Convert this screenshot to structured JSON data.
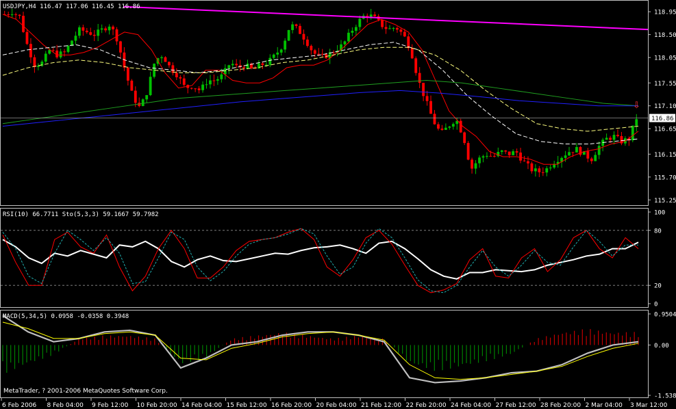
{
  "window": {
    "symbol_header": "USDJPY,H4  116.47 117.06 116.45 116.86",
    "copyright": "MetaTrader, ? 2001-2006 MetaQuotes Software Corp."
  },
  "colors": {
    "background": "#000000",
    "border": "#c0c0c0",
    "bull_candle": "#00c000",
    "bear_candle": "#ff0000",
    "trendline": "#ff00ff",
    "ma_fast": "#ff0000",
    "ma_mid": "#ffffff",
    "ma_slow": "#ffff80",
    "ma_green": "#20a020",
    "ma_blue": "#2020ff",
    "rsi": "#ffffff",
    "stoch_main": "#ff0000",
    "stoch_signal": "#20b0b0",
    "macd_main": "#c0c0c0",
    "macd_signal": "#ffff00",
    "macd_hist_up": "#c00000",
    "macd_hist_down": "#008000"
  },
  "chart_data": [
    {
      "type": "candlestick",
      "title": "USDJPY,H4  116.47 117.06 116.45 116.86",
      "ylim": [
        115.2,
        119.1
      ],
      "y_ticks": [
        "118.95",
        "118.50",
        "118.05",
        "117.55",
        "117.10",
        "116.86",
        "116.65",
        "116.15",
        "115.70",
        "115.25"
      ],
      "current_price": 116.86,
      "current_price_label": "116.86",
      "x_tick_labels": [
        "6 Feb 2006",
        "8 Feb 04:00",
        "9 Feb 12:00",
        "10 Feb 20:00",
        "14 Feb 04:00",
        "15 Feb 12:00",
        "16 Feb 20:00",
        "20 Feb 04:00",
        "21 Feb 12:00",
        "22 Feb 20:00",
        "24 Feb 04:00",
        "27 Feb 12:00",
        "28 Feb 20:00",
        "2 Mar 04:00",
        "3 Mar 12:00"
      ],
      "arrow_marker": "⇩",
      "close_path": [
        118.9,
        118.95,
        118.85,
        118.3,
        117.9,
        117.95,
        118.2,
        118.1,
        118.15,
        118.4,
        118.6,
        118.55,
        118.5,
        118.6,
        118.7,
        118.4,
        117.8,
        117.3,
        117.05,
        117.4,
        118.0,
        118.1,
        117.85,
        117.7,
        117.45,
        117.5,
        117.4,
        117.6,
        117.6,
        117.7,
        117.95,
        117.85,
        117.9,
        117.8,
        117.9,
        117.95,
        118.1,
        118.3,
        118.7,
        118.6,
        118.4,
        118.15,
        118.05,
        118.1,
        118.2,
        118.3,
        118.55,
        118.75,
        118.9,
        118.85,
        118.7,
        118.6,
        118.65,
        118.5,
        118.2,
        117.6,
        117.2,
        116.8,
        116.55,
        116.7,
        116.85,
        116.5,
        115.85,
        116.05,
        116.15,
        116.1,
        116.2,
        116.15,
        116.2,
        116.0,
        115.85,
        115.8,
        115.85,
        116.0,
        116.1,
        116.2,
        116.25,
        116.15,
        116.05,
        116.3,
        116.45,
        116.5,
        116.4,
        116.45,
        116.86
      ],
      "moving_averages": [
        {
          "color": "ma_fast",
          "style": "solid",
          "values": [
            118.9,
            118.8,
            118.55,
            118.3,
            118.1,
            118.1,
            118.15,
            118.25,
            118.4,
            118.55,
            118.5,
            118.2,
            117.75,
            117.45,
            117.5,
            117.8,
            117.8,
            117.6,
            117.55,
            117.55,
            117.65,
            117.85,
            117.9,
            117.9,
            118.0,
            118.2,
            118.45,
            118.7,
            118.8,
            118.7,
            118.55,
            118.2,
            117.6,
            117.0,
            116.7,
            116.5,
            116.2,
            116.1,
            116.1,
            116.05,
            115.95,
            115.95,
            116.1,
            116.2,
            116.25,
            116.35,
            116.4,
            116.6
          ]
        },
        {
          "color": "ma_mid",
          "style": "dashed",
          "values": [
            118.1,
            118.2,
            118.25,
            118.3,
            118.2,
            118.0,
            117.85,
            117.8,
            117.75,
            117.8,
            117.9,
            118.0,
            118.05,
            118.1,
            118.2,
            118.3,
            118.35,
            118.2,
            117.8,
            117.3,
            116.9,
            116.55,
            116.4,
            116.35,
            116.35,
            116.4,
            116.45
          ]
        },
        {
          "color": "ma_slow",
          "style": "dashed",
          "values": [
            117.7,
            117.85,
            117.95,
            118.0,
            117.95,
            117.85,
            117.8,
            117.75,
            117.75,
            117.8,
            117.85,
            117.95,
            118.0,
            118.1,
            118.2,
            118.25,
            118.25,
            118.1,
            117.8,
            117.4,
            117.05,
            116.75,
            116.65,
            116.6,
            116.65,
            116.7
          ]
        },
        {
          "color": "ma_green",
          "style": "solid",
          "values": [
            116.75,
            116.85,
            116.95,
            117.05,
            117.15,
            117.25,
            117.3,
            117.35,
            117.4,
            117.45,
            117.5,
            117.55,
            117.6,
            117.55,
            117.45,
            117.35,
            117.25,
            117.15,
            117.1
          ]
        },
        {
          "color": "ma_blue",
          "style": "solid",
          "values": [
            116.7,
            116.78,
            116.86,
            116.94,
            117.02,
            117.1,
            117.18,
            117.24,
            117.3,
            117.36,
            117.4,
            117.35,
            117.28,
            117.2,
            117.15,
            117.1,
            117.1
          ]
        }
      ],
      "trendline": {
        "from": 119.05,
        "to": 118.6
      }
    },
    {
      "type": "line",
      "title": "RSI(10) 66.7711  Sto(5,3,3) 59.1667 59.7982",
      "ylim": [
        0,
        100
      ],
      "y_ticks": [
        "100",
        "80",
        "20",
        "0"
      ],
      "levels": [
        80,
        20
      ],
      "series": [
        {
          "name": "RSI(10)",
          "color": "rsi",
          "values": [
            70,
            62,
            50,
            44,
            55,
            52,
            58,
            54,
            50,
            64,
            62,
            68,
            60,
            46,
            40,
            48,
            52,
            47,
            46,
            49,
            52,
            55,
            54,
            58,
            61,
            62,
            64,
            60,
            55,
            66,
            68,
            60,
            49,
            37,
            30,
            27,
            34,
            34,
            37,
            36,
            35,
            37,
            42,
            45,
            48,
            52,
            54,
            60,
            60,
            67
          ]
        },
        {
          "name": "Sto main",
          "color": "stoch_main",
          "values": [
            75,
            45,
            20,
            20,
            70,
            78,
            62,
            55,
            75,
            40,
            14,
            30,
            60,
            80,
            60,
            28,
            28,
            40,
            58,
            68,
            70,
            72,
            78,
            82,
            70,
            40,
            30,
            48,
            72,
            80,
            65,
            42,
            20,
            12,
            15,
            22,
            48,
            60,
            30,
            28,
            50,
            60,
            35,
            48,
            72,
            80,
            60,
            50,
            72,
            60
          ]
        },
        {
          "name": "Sto signal",
          "color": "stoch_signal",
          "values": [
            78,
            60,
            30,
            22,
            55,
            80,
            70,
            58,
            72,
            55,
            22,
            24,
            50,
            78,
            70,
            40,
            25,
            35,
            52,
            65,
            70,
            72,
            76,
            82,
            76,
            52,
            32,
            40,
            66,
            82,
            72,
            50,
            26,
            14,
            12,
            20,
            40,
            58,
            40,
            30,
            42,
            58,
            45,
            42,
            62,
            80,
            68,
            52,
            64,
            64
          ]
        }
      ]
    },
    {
      "type": "bar",
      "title": "MACD(5,34,5) 0.0958 -0.0358 0.3948",
      "ylim": [
        -1.5381,
        0.9504
      ],
      "y_ticks": [
        "0.9504",
        "0.00",
        "-1.5381"
      ],
      "series": [
        {
          "name": "MACD main",
          "color": "macd_main",
          "values": [
            0.9,
            0.4,
            0.1,
            0.2,
            0.4,
            0.45,
            0.3,
            -0.7,
            -0.4,
            0.0,
            0.1,
            0.3,
            0.4,
            0.4,
            0.3,
            0.1,
            -1.0,
            -1.15,
            -1.1,
            -1.0,
            -0.85,
            -0.8,
            -0.6,
            -0.25,
            0.0,
            0.1
          ]
        },
        {
          "name": "MACD signal",
          "color": "macd_signal",
          "values": [
            0.7,
            0.5,
            0.2,
            0.2,
            0.35,
            0.4,
            0.3,
            -0.4,
            -0.45,
            -0.1,
            0.05,
            0.25,
            0.35,
            0.4,
            0.3,
            0.15,
            -0.6,
            -1.0,
            -1.05,
            -1.0,
            -0.9,
            -0.8,
            -0.65,
            -0.35,
            -0.1,
            0.05
          ]
        },
        {
          "name": "histogram",
          "values": [
            -0.9,
            -0.6,
            -0.3,
            0.2,
            0.3,
            0.3,
            0.2,
            -0.6,
            -0.4,
            0.2,
            0.3,
            0.4,
            0.3,
            0.2,
            0.3,
            0.2,
            -0.6,
            -0.8,
            -0.7,
            -0.5,
            -0.3,
            0.2,
            0.4,
            0.5,
            0.4,
            0.4
          ]
        }
      ]
    }
  ]
}
